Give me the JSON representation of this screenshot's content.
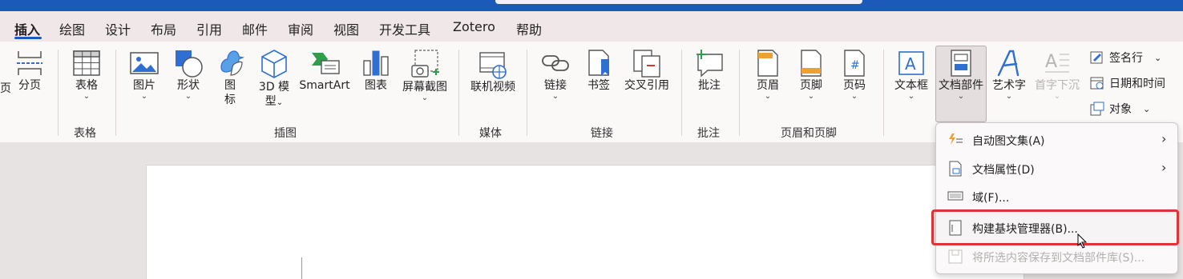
{
  "tabs": [
    {
      "label": "插入",
      "active": true
    },
    {
      "label": "绘图"
    },
    {
      "label": "设计"
    },
    {
      "label": "布局"
    },
    {
      "label": "引用"
    },
    {
      "label": "邮件"
    },
    {
      "label": "审阅"
    },
    {
      "label": "视图"
    },
    {
      "label": "开发工具"
    },
    {
      "label": "Zotero"
    },
    {
      "label": "帮助"
    }
  ],
  "ribbon": {
    "pages": {
      "cut_label": "页",
      "page_break": "分页"
    },
    "table": {
      "label": "表格",
      "group": "表格"
    },
    "illustrations": {
      "picture": "图片",
      "shapes": "形状",
      "icons_1": "图",
      "icons_2": "标",
      "model_1": "3D 模",
      "model_2": "型",
      "smartart": "SmartArt",
      "chart": "图表",
      "screenshot": "屏幕截图",
      "group": "插图"
    },
    "media": {
      "online_video": "联机视频",
      "group": "媒体"
    },
    "links": {
      "link": "链接",
      "bookmark": "书签",
      "cross_ref": "交叉引用",
      "group": "链接"
    },
    "comments": {
      "comment": "批注",
      "group": "批注"
    },
    "header_footer": {
      "header": "页眉",
      "footer": "页脚",
      "page_number": "页码",
      "group": "页眉和页脚"
    },
    "text": {
      "textbox": "文本框",
      "quick_parts": "文档部件",
      "wordart": "艺术字",
      "dropcap": "首字下沉",
      "signature": "签名行",
      "datetime": "日期和时间",
      "object": "对象"
    }
  },
  "dropdown": {
    "items": [
      {
        "label": "自动图文集(A)",
        "submenu": true,
        "disabled": false
      },
      {
        "label": "文档属性(D)",
        "submenu": true,
        "disabled": false
      },
      {
        "label": "域(F)...",
        "submenu": false,
        "disabled": false
      },
      {
        "label": "构建基块管理器(B)...",
        "submenu": false,
        "disabled": false,
        "highlighted": true
      },
      {
        "label": "将所选内容保存到文档部件库(S)...",
        "submenu": false,
        "disabled": true
      }
    ]
  },
  "colors": {
    "accent": "#1b5ab8",
    "highlight": "#e03333",
    "green": "#2e9e4a"
  }
}
